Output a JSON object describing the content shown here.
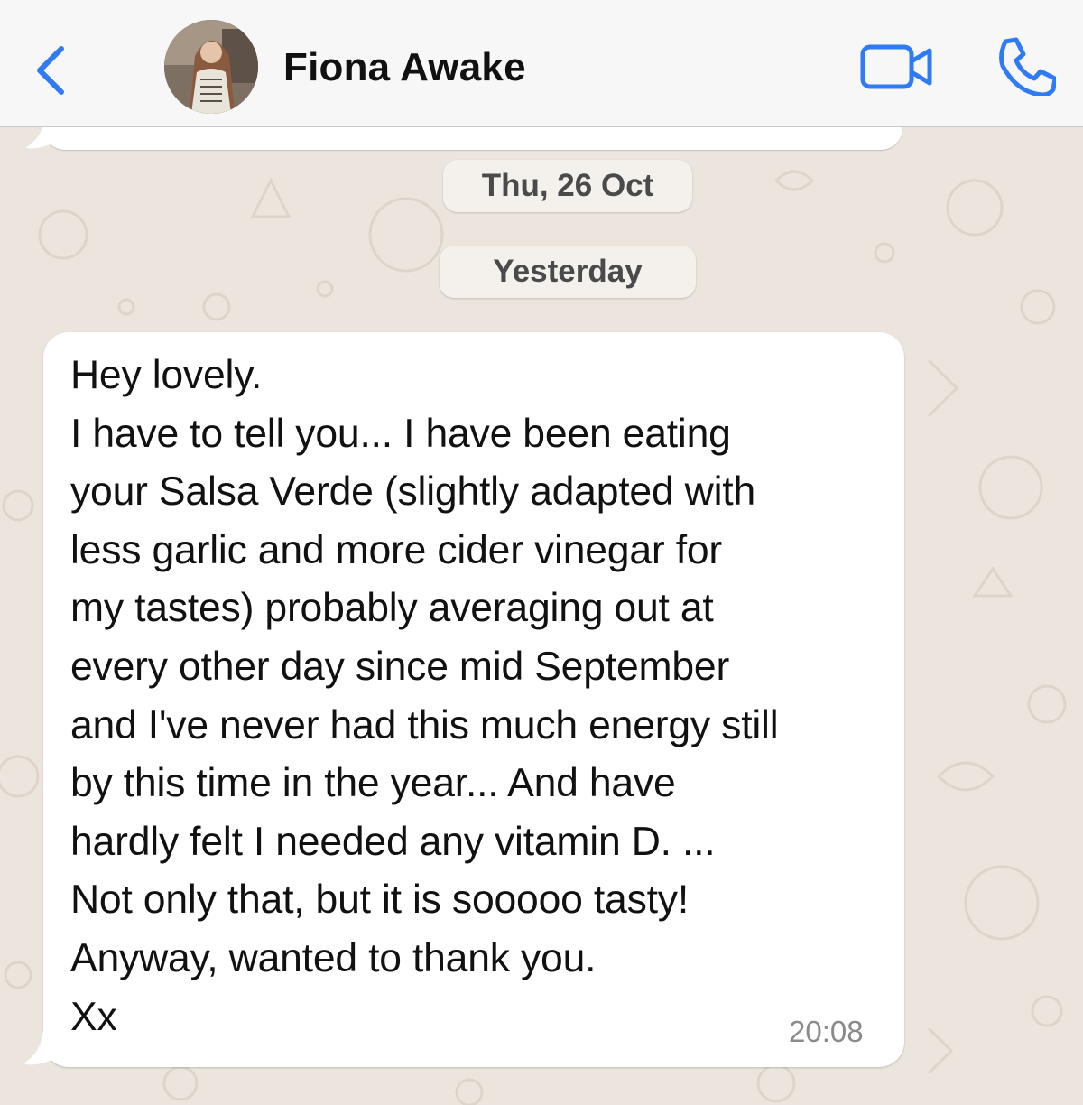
{
  "header": {
    "back_icon": "chevron-left-icon",
    "contact_name": "Fiona Awake",
    "video_icon": "video-camera-icon",
    "call_icon": "phone-icon",
    "accent_color": "#2F7BF6"
  },
  "chat": {
    "date_separators": [
      "Thu, 26 Oct",
      "Yesterday"
    ],
    "message": {
      "lines": [
        "Hey lovely.",
        "I have to tell you... I have been eating",
        "your Salsa Verde (slightly adapted with",
        "less garlic and more cider vinegar for",
        "my tastes) probably averaging out at",
        "every other day since mid September",
        "and I've never had this much energy still",
        "by this time in the year... And have",
        "hardly felt I needed any vitamin D. ...",
        "Not only that, but it is sooooo tasty!",
        "Anyway, wanted to thank you.",
        "Xx"
      ],
      "time": "20:08"
    }
  },
  "colors": {
    "wallpaper": "#ECE5DD",
    "bubble": "#FFFFFF",
    "header": "#F7F7F7"
  }
}
